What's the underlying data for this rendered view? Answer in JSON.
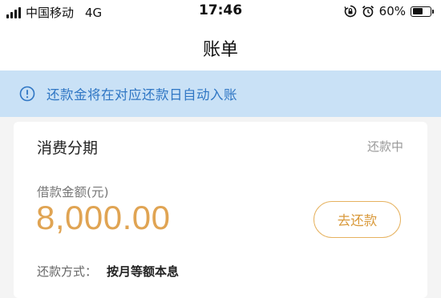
{
  "status_bar": {
    "carrier": "中国移动",
    "network": "4G",
    "time": "17:46",
    "battery_percent": "60%",
    "battery_level": 0.6,
    "icons": [
      "signal-icon",
      "orientation-lock-icon",
      "alarm-icon",
      "battery-icon"
    ]
  },
  "header": {
    "title": "账单"
  },
  "notice": {
    "icon": "info-icon",
    "text": "还款金将在对应还款日自动入账",
    "background": "#c9e1f6",
    "text_color": "#2f76c4"
  },
  "bill_card": {
    "title": "消费分期",
    "status": "还款中",
    "amount_label": "借款金额(元)",
    "amount": "8,000.00",
    "amount_color": "#e0a453",
    "repay_button_label": "去还款",
    "repay_method_label": "还款方式：",
    "repay_method_value": "按月等额本息"
  }
}
